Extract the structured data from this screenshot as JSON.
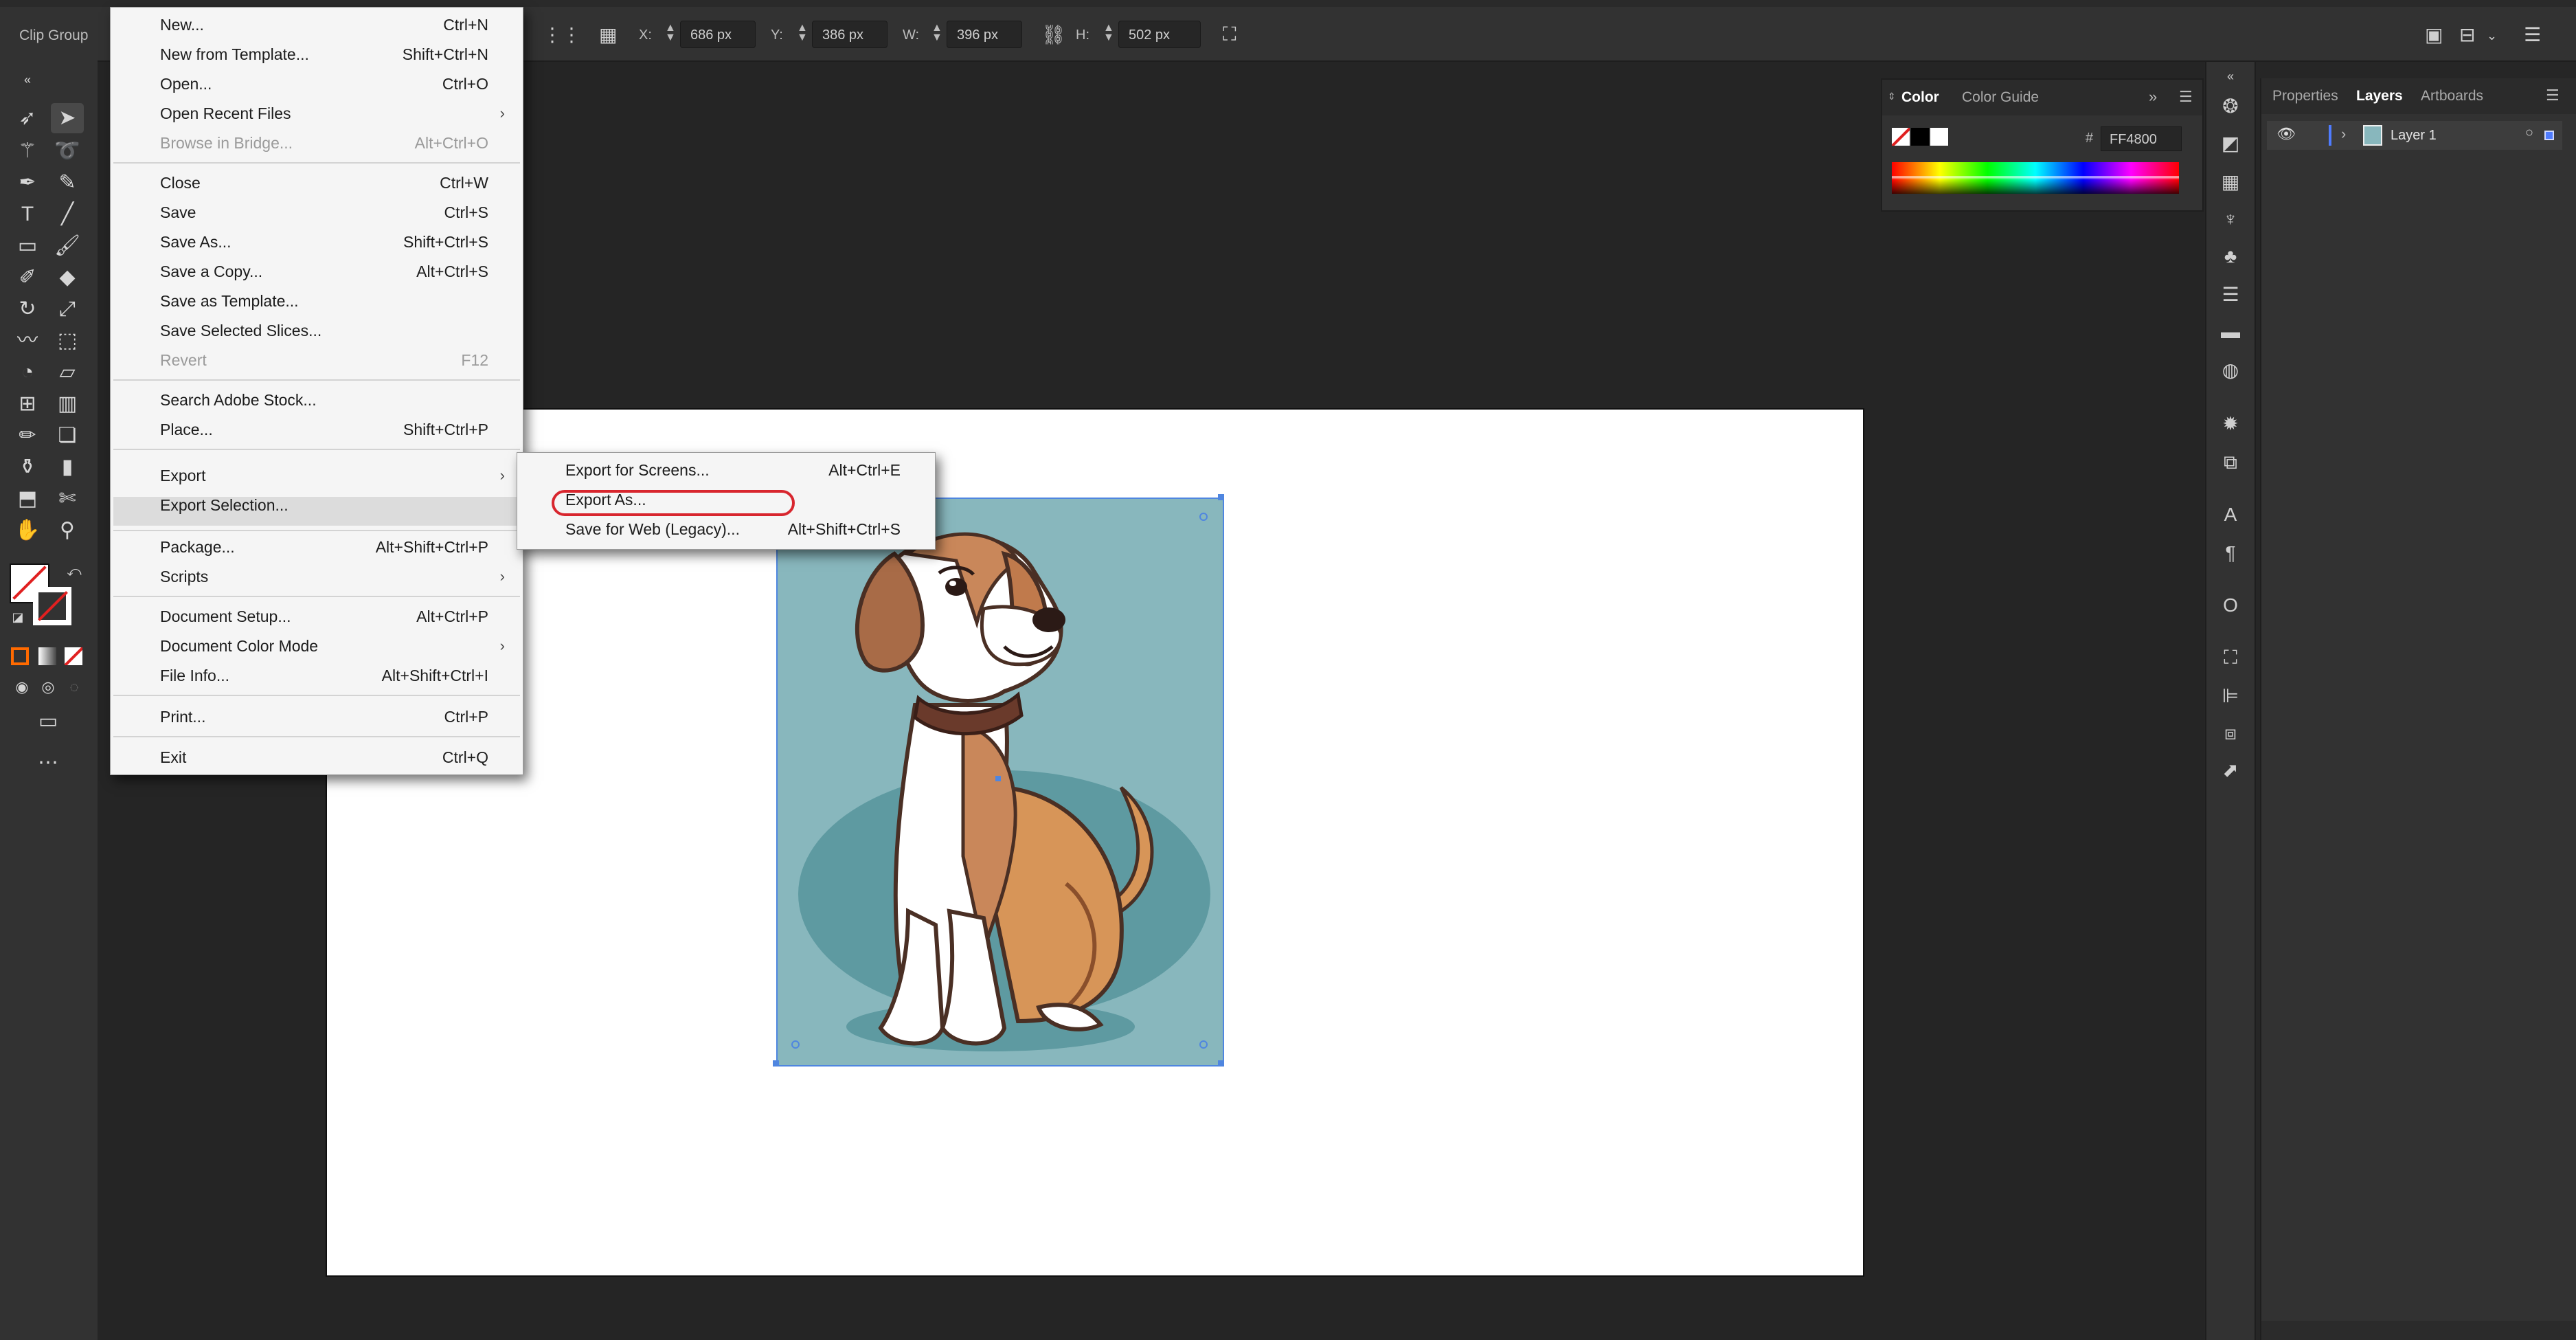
{
  "app": {
    "context_label": "Clip Group"
  },
  "control_bar": {
    "x_label": "X:",
    "x_value": "686 px",
    "y_label": "Y:",
    "y_value": "386 px",
    "w_label": "W:",
    "w_value": "396 px",
    "h_label": "H:",
    "h_value": "502 px"
  },
  "file_menu": {
    "items": [
      {
        "label": "New...",
        "shortcut": "Ctrl+N"
      },
      {
        "label": "New from Template...",
        "shortcut": "Shift+Ctrl+N"
      },
      {
        "label": "Open...",
        "shortcut": "Ctrl+O"
      },
      {
        "label": "Open Recent Files",
        "shortcut": ""
      },
      {
        "label": "Browse in Bridge...",
        "shortcut": "Alt+Ctrl+O"
      },
      {
        "label": "Close",
        "shortcut": "Ctrl+W"
      },
      {
        "label": "Save",
        "shortcut": "Ctrl+S"
      },
      {
        "label": "Save As...",
        "shortcut": "Shift+Ctrl+S"
      },
      {
        "label": "Save a Copy...",
        "shortcut": "Alt+Ctrl+S"
      },
      {
        "label": "Save as Template...",
        "shortcut": ""
      },
      {
        "label": "Save Selected Slices...",
        "shortcut": ""
      },
      {
        "label": "Revert",
        "shortcut": "F12"
      },
      {
        "label": "Search Adobe Stock...",
        "shortcut": ""
      },
      {
        "label": "Place...",
        "shortcut": "Shift+Ctrl+P"
      },
      {
        "label": "Export",
        "shortcut": ""
      },
      {
        "label": "Export Selection...",
        "shortcut": ""
      },
      {
        "label": "Package...",
        "shortcut": "Alt+Shift+Ctrl+P"
      },
      {
        "label": "Scripts",
        "shortcut": ""
      },
      {
        "label": "Document Setup...",
        "shortcut": "Alt+Ctrl+P"
      },
      {
        "label": "Document Color Mode",
        "shortcut": ""
      },
      {
        "label": "File Info...",
        "shortcut": "Alt+Shift+Ctrl+I"
      },
      {
        "label": "Print...",
        "shortcut": "Ctrl+P"
      },
      {
        "label": "Exit",
        "shortcut": "Ctrl+Q"
      }
    ]
  },
  "export_submenu": {
    "items": [
      {
        "label": "Export for Screens...",
        "shortcut": "Alt+Ctrl+E"
      },
      {
        "label": "Export As...",
        "shortcut": ""
      },
      {
        "label": "Save for Web (Legacy)...",
        "shortcut": "Alt+Shift+Ctrl+S"
      }
    ]
  },
  "color_panel": {
    "tabs": [
      "Color",
      "Color Guide"
    ],
    "hex_prefix": "#",
    "hex_value": "FF4800"
  },
  "layers_panel": {
    "tabs": [
      "Properties",
      "Layers",
      "Artboards"
    ],
    "layer_name": "Layer 1"
  },
  "colors": {
    "selection": "#4f86e0",
    "highlight_ring": "#d8262e",
    "image_background": "#88b7bd"
  },
  "icons": {
    "toolbar": [
      "selection-tool-icon",
      "direct-selection-tool-icon",
      "magic-wand-icon",
      "lasso-icon",
      "pen-icon",
      "curvature-icon",
      "type-icon",
      "line-icon",
      "rectangle-icon",
      "paintbrush-icon",
      "shaper-icon",
      "eraser-icon",
      "rotate-icon",
      "scale-icon",
      "warp-icon",
      "free-transform-icon",
      "shape-builder-icon",
      "perspective-icon",
      "mesh-icon",
      "gradient-icon",
      "eyedropper-icon",
      "blend-icon",
      "symbol-sprayer-icon",
      "graph-icon",
      "artboard-icon",
      "slice-icon",
      "hand-icon",
      "zoom-icon"
    ]
  }
}
